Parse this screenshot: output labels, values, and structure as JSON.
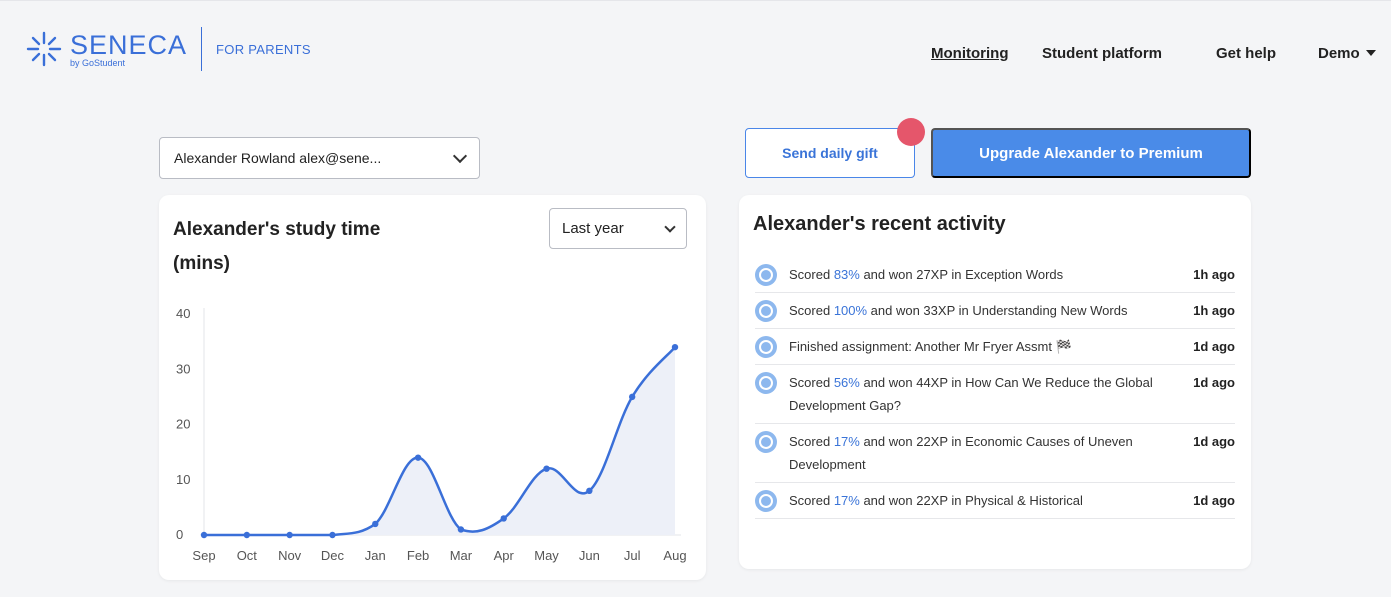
{
  "header": {
    "brand": "SENECA",
    "brand_sub": "by GoStudent",
    "section": "FOR PARENTS",
    "nav": [
      {
        "label": "Monitoring"
      },
      {
        "label": "Student platform"
      },
      {
        "label": "Get help"
      },
      {
        "label": "Demo"
      }
    ]
  },
  "student_select": {
    "value": "Alexander Rowland alex@sene..."
  },
  "actions": {
    "gift": "Send daily gift",
    "premium": "Upgrade Alexander to Premium"
  },
  "colors": {
    "accent": "#4a8be8",
    "notification": "#e5566b",
    "line": "#3a6fd8"
  },
  "study": {
    "title": "Alexander's study time (mins)",
    "period": "Last year"
  },
  "chart_data": {
    "type": "line",
    "categories": [
      "Sep",
      "Oct",
      "Nov",
      "Dec",
      "Jan",
      "Feb",
      "Mar",
      "Apr",
      "May",
      "Jun",
      "Jul",
      "Aug"
    ],
    "values": [
      0,
      0,
      0,
      0,
      2,
      14,
      1,
      3,
      12,
      8,
      25,
      34
    ],
    "yticks": [
      0,
      10,
      20,
      30,
      40
    ],
    "ylim": [
      0,
      40
    ],
    "title": "Alexander's study time (mins)",
    "xlabel": "",
    "ylabel": ""
  },
  "activity": {
    "title": "Alexander's recent activity",
    "items": [
      {
        "pre": "Scored ",
        "pct": "83%",
        "post": " and won 27XP in Exception Words",
        "time": "1h ago"
      },
      {
        "pre": "Scored ",
        "pct": "100%",
        "post": " and won 33XP in Understanding New Words",
        "time": "1h ago"
      },
      {
        "pre": "Finished assignment: Another Mr Fryer Assmt 🏁",
        "pct": "",
        "post": "",
        "time": "1d ago"
      },
      {
        "pre": "Scored ",
        "pct": "56%",
        "post": " and won 44XP in How Can We Reduce the Global Development Gap?",
        "time": "1d ago"
      },
      {
        "pre": "Scored ",
        "pct": "17%",
        "post": " and won 22XP in Economic Causes of Uneven Development",
        "time": "1d ago"
      },
      {
        "pre": "Scored ",
        "pct": "17%",
        "post": " and won 22XP in Physical & Historical",
        "time": "1d ago"
      }
    ]
  }
}
